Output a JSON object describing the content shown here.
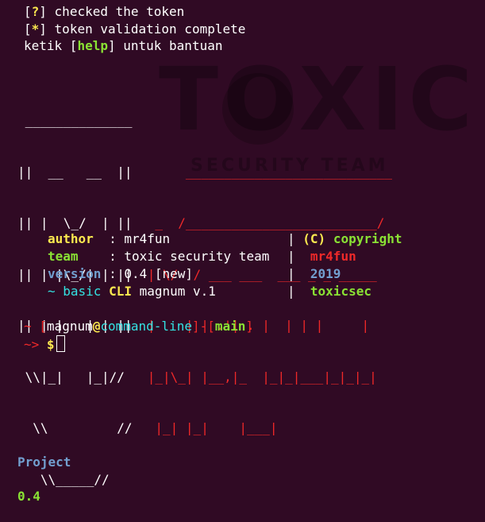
{
  "messages": {
    "checked": {
      "bracket_mark": "?",
      "text": "checked the token"
    },
    "validated": {
      "bracket_mark": "*",
      "text": "token validation complete"
    },
    "help": {
      "prefix": "ketik ",
      "keyword": "help",
      "suffix": " untuk bantuan"
    }
  },
  "banner": {
    "ascii_lines": [
      " ______________",
      "||  __   __  ||       ___________________________",
      "|| |  \\_/  | ||   _  /_________________________/",
      "|| | |\\_/| | ||  | \\/  / ___ ___  ___ _ _ _____",
      "|| | |   | | ||  |    | | .'| . |  | | |     |",
      " \\\\|_|   |_|//   |_|\\_| |__,|_  |_|_|___|_|_|_|",
      "  \\\\         //   |_| |_|    |___|"
    ],
    "project_label": "Project",
    "project_version": "0.4"
  },
  "info": {
    "author_key": "author",
    "author_value": ": mr4fun",
    "team_key": "team",
    "team_value": ": toxic security team",
    "version_key": "version",
    "version_value": ": 0.4 [new]",
    "desc_prefix": "~ basic ",
    "desc_cli": "CLI",
    "desc_suffix": " magnum v.1",
    "copyright_mark": "(C)",
    "copyright_word": "copyright",
    "author_right": "mr4fun",
    "year": "2019",
    "team_short": "toxicsec"
  },
  "prompt": {
    "tilde": "~",
    "user": "magnum",
    "at": "@",
    "host": "command-line",
    "dash": "-",
    "branch": "main",
    "arrow": "~>",
    "dollar": "$"
  },
  "watermark": {
    "brand": "TOXIC",
    "subtitle": "SECURITY TEAM"
  },
  "colors": {
    "background": "#300a24",
    "yellow": "#fce94f",
    "green": "#8ae234",
    "red": "#ef2929",
    "blue": "#729fcf",
    "cyan": "#34e2e2"
  }
}
